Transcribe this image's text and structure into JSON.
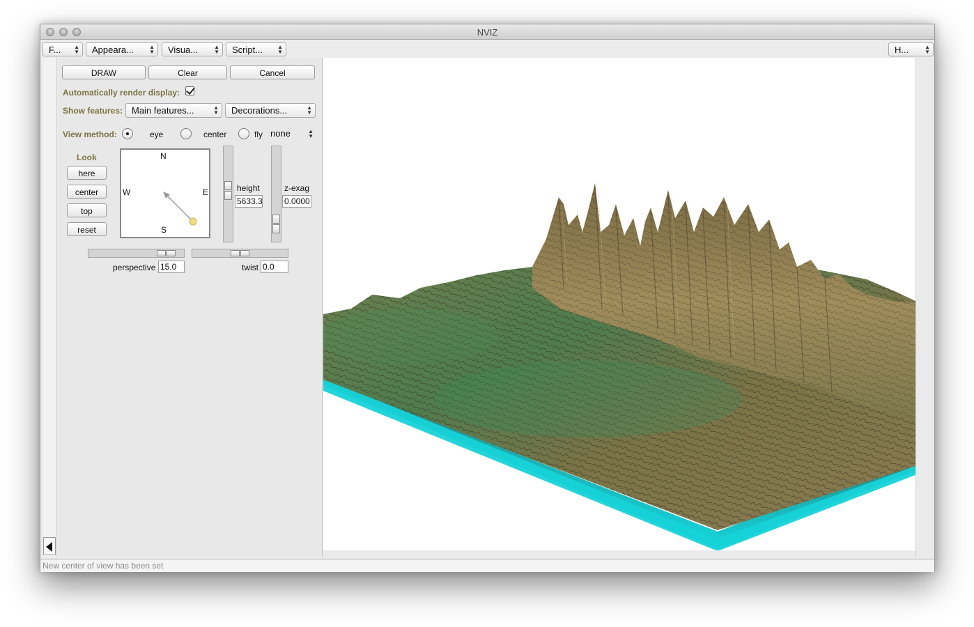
{
  "window": {
    "title": "NVIZ"
  },
  "menubar": {
    "file": "F...",
    "appearance": "Appeara...",
    "visualize": "Visua...",
    "scripting": "Script...",
    "help": "H..."
  },
  "toolbar": {
    "draw": "DRAW",
    "clear": "Clear",
    "cancel": "Cancel"
  },
  "auto_render": {
    "label": "Automatically render display:",
    "checked": true
  },
  "show_features": {
    "label": "Show features:",
    "main": "Main features...",
    "decorations": "Decorations..."
  },
  "view_method": {
    "label": "View method:",
    "options": [
      "eye",
      "center",
      "fly"
    ],
    "selected": "eye",
    "fly_mode": "none"
  },
  "look": {
    "title": "Look",
    "buttons": [
      "here",
      "center",
      "top",
      "reset"
    ]
  },
  "compass": {
    "n": "N",
    "s": "S",
    "e": "E",
    "w": "W"
  },
  "height": {
    "label": "height",
    "value": "5633.3"
  },
  "zexag": {
    "label": "z-exag",
    "value": "0.0000"
  },
  "perspective": {
    "label": "perspective",
    "value": "15.0"
  },
  "twist": {
    "label": "twist",
    "value": "0.0"
  },
  "status": {
    "message": "New center of view has been set"
  },
  "colors": {
    "olive_label": "#7b7444",
    "base_cyan": "#16d3d8",
    "terrain_brown": "#8d7a50",
    "terrain_green": "#4e7c4a"
  }
}
